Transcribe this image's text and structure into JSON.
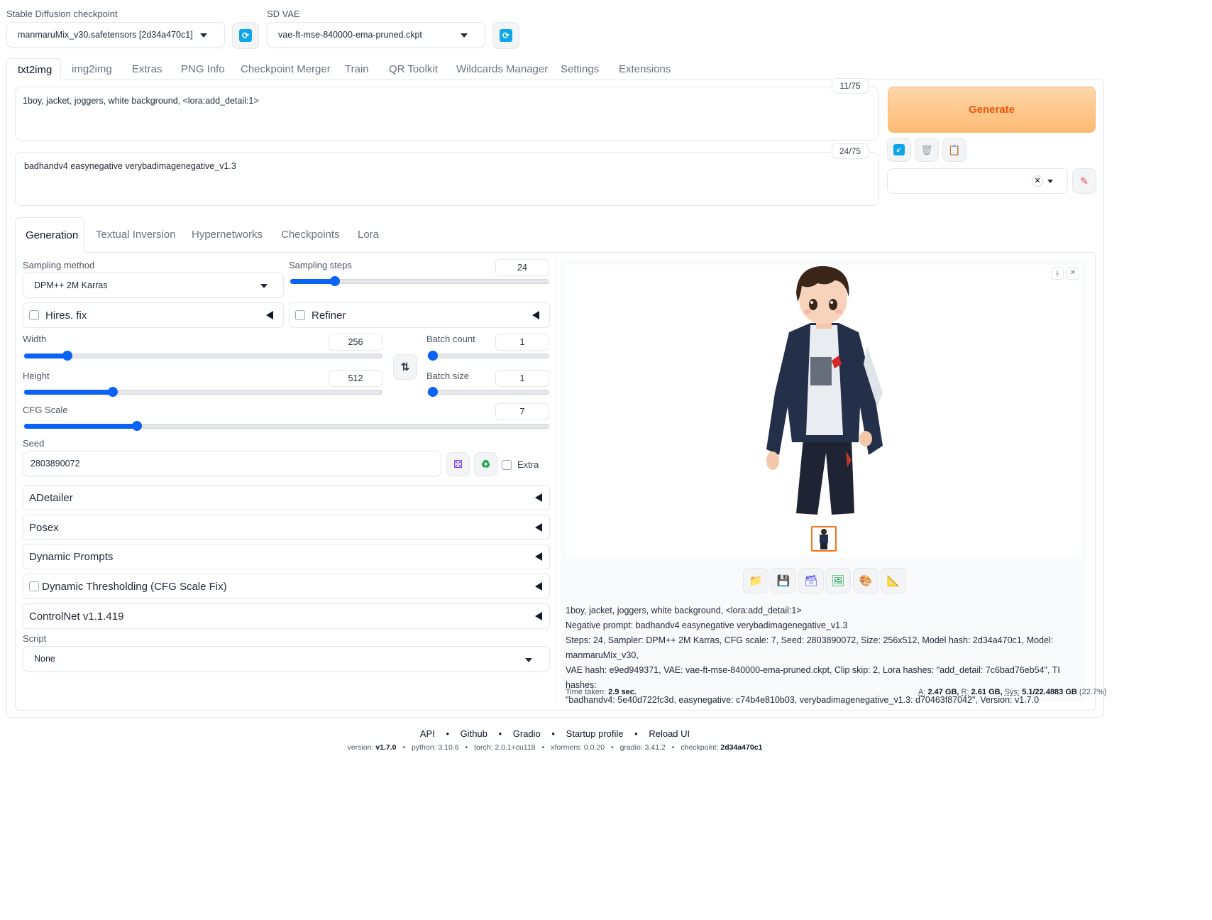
{
  "checkpoint": {
    "label": "Stable Diffusion checkpoint",
    "value": "manmaruMix_v30.safetensors [2d34a470c1]"
  },
  "vae": {
    "label": "SD VAE",
    "value": "vae-ft-mse-840000-ema-pruned.ckpt"
  },
  "tabs": [
    "txt2img",
    "img2img",
    "Extras",
    "PNG Info",
    "Checkpoint Merger",
    "Train",
    "QR Toolkit",
    "Wildcards Manager",
    "Settings",
    "Extensions"
  ],
  "prompt": {
    "value": "1boy, jacket, joggers, white background, <lora:add_detail:1>",
    "tokens": "11/75"
  },
  "negative": {
    "value": "badhandv4 easynegative verybadimagenegative_v1.3",
    "tokens": "24/75"
  },
  "generate_label": "Generate",
  "subtabs": [
    "Generation",
    "Textual Inversion",
    "Hypernetworks",
    "Checkpoints",
    "Lora"
  ],
  "sampling": {
    "method_label": "Sampling method",
    "method": "DPM++ 2M Karras",
    "steps_label": "Sampling steps",
    "steps": "24",
    "steps_frac": 0.16
  },
  "hires_label": "Hires. fix",
  "refiner_label": "Refiner",
  "width": {
    "label": "Width",
    "value": "256",
    "frac": 0.11
  },
  "height": {
    "label": "Height",
    "value": "512",
    "frac": 0.24
  },
  "batch_count": {
    "label": "Batch count",
    "value": "1",
    "frac": 0.0
  },
  "batch_size": {
    "label": "Batch size",
    "value": "1",
    "frac": 0.0
  },
  "cfg": {
    "label": "CFG Scale",
    "value": "7",
    "frac": 0.21
  },
  "seed": {
    "label": "Seed",
    "value": "2803890072",
    "extra_label": "Extra"
  },
  "accordions": [
    "ADetailer",
    "Posex",
    "Dynamic Prompts",
    "Dynamic Thresholding (CFG Scale Fix)",
    "ControlNet v1.1.419"
  ],
  "script": {
    "label": "Script",
    "value": "None"
  },
  "output": {
    "info_lines": [
      "1boy, jacket, joggers, white background, <lora:add_detail:1>",
      "Negative prompt: badhandv4 easynegative verybadimagenegative_v1.3",
      "Steps: 24, Sampler: DPM++ 2M Karras, CFG scale: 7, Seed: 2803890072, Size: 256x512, Model hash: 2d34a470c1, Model: manmaruMix_v30,",
      "VAE hash: e9ed949371, VAE: vae-ft-mse-840000-ema-pruned.ckpt, Clip skip: 2, Lora hashes: \"add_detail: 7c6bad76eb54\", TI hashes:",
      "\"badhandv4: 5e40d722fc3d, easynegative: c74b4e810b03, verybadimagenegative_v1.3: d70463f87042\", Version: v1.7.0"
    ],
    "time_label": "Time taken:",
    "time_value": "2.9 sec.",
    "mem_a_label": "A:",
    "mem_a": "2.47 GB,",
    "mem_r_label": "R:",
    "mem_r": "2.61 GB,",
    "mem_s_label": "Sys:",
    "mem_s": "5.1/22.4883 GB",
    "mem_pct": "(22.7%)"
  },
  "footer": {
    "links": [
      "API",
      "Github",
      "Gradio",
      "Startup profile",
      "Reload UI"
    ],
    "versions": [
      {
        "k": "version:",
        "v": "v1.7.0"
      },
      {
        "k": "python:",
        "v": "3.10.6"
      },
      {
        "k": "torch:",
        "v": "2.0.1+cu118"
      },
      {
        "k": "xformers:",
        "v": "0.0.20"
      },
      {
        "k": "gradio:",
        "v": "3.41.2"
      },
      {
        "k": "checkpoint:",
        "v": "2d34a470c1"
      }
    ]
  },
  "colors": {
    "accent": "#0b63f6",
    "generate": "#f97316",
    "refresh": "#0ea5e9"
  },
  "icons": [
    "refresh-icon",
    "swap-icon",
    "dice-icon",
    "recycle-icon",
    "folder-icon",
    "save-icon",
    "zip-icon",
    "image-icon",
    "palette-icon",
    "ruler-icon",
    "download-icon",
    "close-icon",
    "paste-icon",
    "trash-icon",
    "brush-icon"
  ]
}
